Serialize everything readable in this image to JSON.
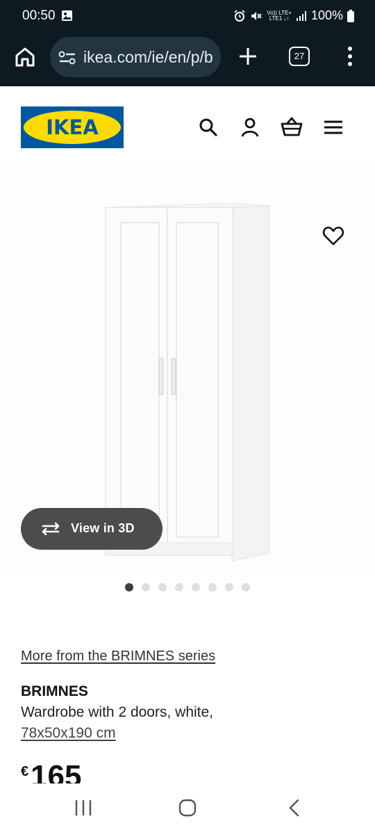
{
  "status_bar": {
    "time": "00:50",
    "network": "LTE+",
    "battery": "100%"
  },
  "browser": {
    "url": "ikea.com/ie/en/p/b",
    "tab_count": "27"
  },
  "site": {
    "logo_text": "IKEA",
    "brand_colors": {
      "blue": "#0058a3",
      "yellow": "#ffdb00"
    }
  },
  "product": {
    "view_3d_label": "View in 3D",
    "image_count": 8,
    "active_image": 1,
    "series_link": "More from the BRIMNES series",
    "name": "BRIMNES",
    "description": "Wardrobe with 2 doors, white,",
    "size": "78x50x190 cm",
    "price_currency": "€",
    "price": "165"
  },
  "icons": [
    "home-icon",
    "site-settings-icon",
    "plus-icon",
    "tabs-icon",
    "more-icon",
    "search-icon",
    "profile-icon",
    "cart-icon",
    "hamburger-icon",
    "heart-icon",
    "rotate-3d-icon"
  ]
}
